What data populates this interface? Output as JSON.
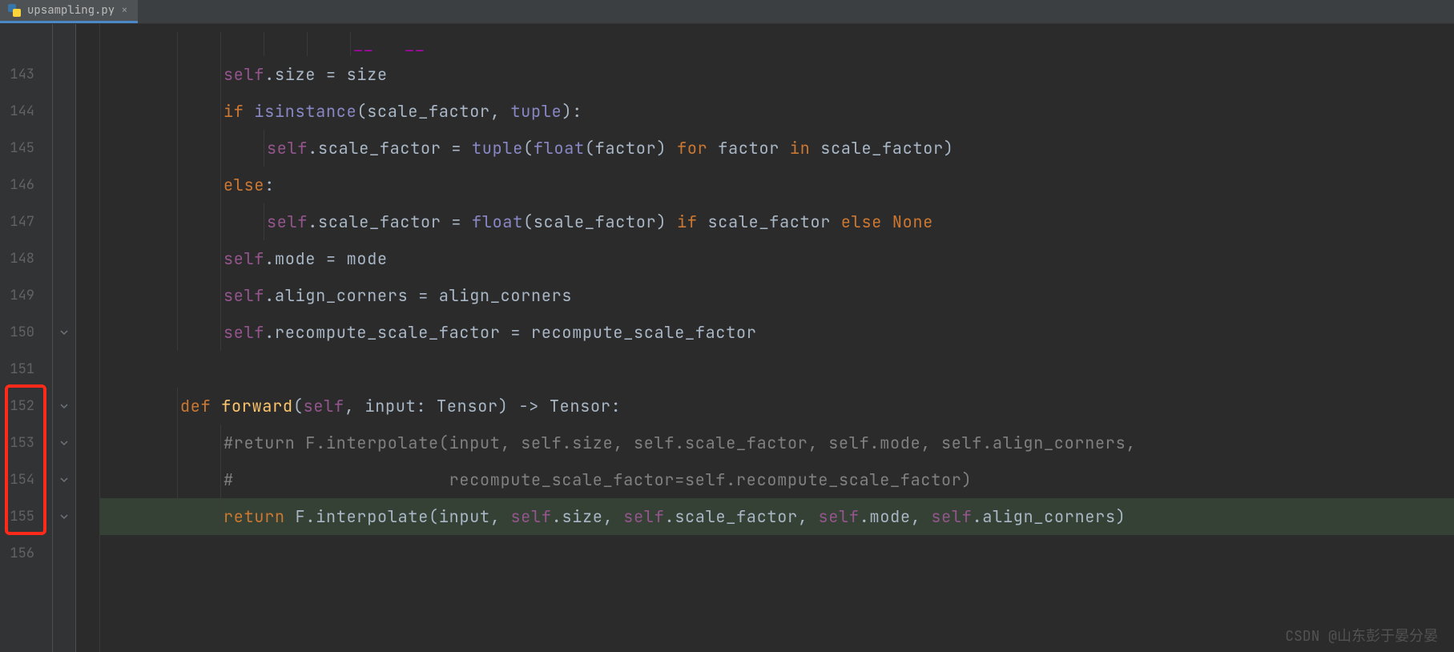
{
  "tab": {
    "filename": "upsampling.py",
    "close_glyph": "×"
  },
  "gutter": {
    "numbers": [
      "143",
      "144",
      "145",
      "146",
      "147",
      "148",
      "149",
      "150",
      "151",
      "152",
      "153",
      "154",
      "155",
      "156"
    ]
  },
  "redbox": {
    "start_index": 9,
    "end_index": 12
  },
  "fold_marks": {
    "150": true,
    "152": true,
    "153": true,
    "154": true,
    "155": true
  },
  "code": {
    "topcut": [
      {
        "cls": "c-dunder",
        "t": "__"
      },
      {
        "cls": "c-id",
        "t": "   "
      },
      {
        "cls": "c-dunder",
        "t": "__"
      }
    ],
    "lines": [
      {
        "indent": 2,
        "tokens": [
          {
            "cls": "c-self",
            "t": "self"
          },
          {
            "cls": "c-dot",
            "t": "."
          },
          {
            "cls": "c-id",
            "t": "size "
          },
          {
            "cls": "c-op",
            "t": "= "
          },
          {
            "cls": "c-id",
            "t": "size"
          }
        ]
      },
      {
        "indent": 2,
        "tokens": [
          {
            "cls": "c-kw",
            "t": "if "
          },
          {
            "cls": "c-builtin",
            "t": "isinstance"
          },
          {
            "cls": "c-punc",
            "t": "("
          },
          {
            "cls": "c-id",
            "t": "scale_factor"
          },
          {
            "cls": "c-punc",
            "t": ", "
          },
          {
            "cls": "c-builtin",
            "t": "tuple"
          },
          {
            "cls": "c-punc",
            "t": "):"
          }
        ]
      },
      {
        "indent": 3,
        "tokens": [
          {
            "cls": "c-self",
            "t": "self"
          },
          {
            "cls": "c-dot",
            "t": "."
          },
          {
            "cls": "c-id",
            "t": "scale_factor "
          },
          {
            "cls": "c-op",
            "t": "= "
          },
          {
            "cls": "c-builtin",
            "t": "tuple"
          },
          {
            "cls": "c-punc",
            "t": "("
          },
          {
            "cls": "c-builtin",
            "t": "float"
          },
          {
            "cls": "c-punc",
            "t": "("
          },
          {
            "cls": "c-id",
            "t": "factor"
          },
          {
            "cls": "c-punc",
            "t": ") "
          },
          {
            "cls": "c-kw",
            "t": "for "
          },
          {
            "cls": "c-id",
            "t": "factor "
          },
          {
            "cls": "c-kw",
            "t": "in "
          },
          {
            "cls": "c-id",
            "t": "scale_factor"
          },
          {
            "cls": "c-punc",
            "t": ")"
          }
        ]
      },
      {
        "indent": 2,
        "tokens": [
          {
            "cls": "c-kw",
            "t": "else"
          },
          {
            "cls": "c-punc",
            "t": ":"
          }
        ]
      },
      {
        "indent": 3,
        "tokens": [
          {
            "cls": "c-self",
            "t": "self"
          },
          {
            "cls": "c-dot",
            "t": "."
          },
          {
            "cls": "c-id",
            "t": "scale_factor "
          },
          {
            "cls": "c-op",
            "t": "= "
          },
          {
            "cls": "c-builtin",
            "t": "float"
          },
          {
            "cls": "c-punc",
            "t": "("
          },
          {
            "cls": "c-id",
            "t": "scale_factor"
          },
          {
            "cls": "c-punc",
            "t": ") "
          },
          {
            "cls": "c-kw",
            "t": "if "
          },
          {
            "cls": "c-id",
            "t": "scale_factor "
          },
          {
            "cls": "c-kw",
            "t": "else "
          },
          {
            "cls": "c-kw",
            "t": "None"
          }
        ]
      },
      {
        "indent": 2,
        "tokens": [
          {
            "cls": "c-self",
            "t": "self"
          },
          {
            "cls": "c-dot",
            "t": "."
          },
          {
            "cls": "c-id",
            "t": "mode "
          },
          {
            "cls": "c-op",
            "t": "= "
          },
          {
            "cls": "c-id",
            "t": "mode"
          }
        ]
      },
      {
        "indent": 2,
        "tokens": [
          {
            "cls": "c-self",
            "t": "self"
          },
          {
            "cls": "c-dot",
            "t": "."
          },
          {
            "cls": "c-id",
            "t": "align_corners "
          },
          {
            "cls": "c-op",
            "t": "= "
          },
          {
            "cls": "c-id",
            "t": "align_corners"
          }
        ]
      },
      {
        "indent": 2,
        "tokens": [
          {
            "cls": "c-self",
            "t": "self"
          },
          {
            "cls": "c-dot",
            "t": "."
          },
          {
            "cls": "c-id",
            "t": "recompute_scale_factor "
          },
          {
            "cls": "c-op",
            "t": "= "
          },
          {
            "cls": "c-id",
            "t": "recompute_scale_factor"
          }
        ]
      },
      {
        "indent": 0,
        "tokens": []
      },
      {
        "indent": 1,
        "tokens": [
          {
            "cls": "c-kw",
            "t": "def "
          },
          {
            "cls": "c-fn",
            "t": "forward"
          },
          {
            "cls": "c-punc",
            "t": "("
          },
          {
            "cls": "c-self",
            "t": "self"
          },
          {
            "cls": "c-punc",
            "t": ", "
          },
          {
            "cls": "c-param",
            "t": "input"
          },
          {
            "cls": "c-punc",
            "t": ": "
          },
          {
            "cls": "c-id",
            "t": "Tensor"
          },
          {
            "cls": "c-punc",
            "t": ") -> "
          },
          {
            "cls": "c-id",
            "t": "Tensor"
          },
          {
            "cls": "c-punc",
            "t": ":"
          }
        ]
      },
      {
        "indent": 2,
        "tokens": [
          {
            "cls": "c-comment",
            "t": "#return F.interpolate(input, self.size, self.scale_factor, self.mode, self.align_corners,"
          }
        ]
      },
      {
        "indent": 2,
        "tokens": [
          {
            "cls": "c-comment",
            "t": "#                     recompute_scale_factor=self.recompute_scale_factor)"
          }
        ]
      },
      {
        "indent": 2,
        "hl": true,
        "tokens": [
          {
            "cls": "c-kw",
            "t": "return "
          },
          {
            "cls": "c-id",
            "t": "F"
          },
          {
            "cls": "c-dot",
            "t": "."
          },
          {
            "cls": "c-id",
            "t": "interpolate"
          },
          {
            "cls": "c-punc",
            "t": "("
          },
          {
            "cls": "c-id",
            "t": "input"
          },
          {
            "cls": "c-punc",
            "t": ", "
          },
          {
            "cls": "c-self",
            "t": "self"
          },
          {
            "cls": "c-dot",
            "t": "."
          },
          {
            "cls": "c-id",
            "t": "size"
          },
          {
            "cls": "c-punc",
            "t": ", "
          },
          {
            "cls": "c-self",
            "t": "self"
          },
          {
            "cls": "c-dot",
            "t": "."
          },
          {
            "cls": "c-id",
            "t": "scale_factor"
          },
          {
            "cls": "c-punc",
            "t": ", "
          },
          {
            "cls": "c-self",
            "t": "self"
          },
          {
            "cls": "c-dot",
            "t": "."
          },
          {
            "cls": "c-id",
            "t": "mode"
          },
          {
            "cls": "c-punc",
            "t": ", "
          },
          {
            "cls": "c-self",
            "t": "self"
          },
          {
            "cls": "c-dot",
            "t": "."
          },
          {
            "cls": "c-id",
            "t": "align_corners"
          },
          {
            "cls": "c-punc",
            "t": ")"
          }
        ]
      },
      {
        "indent": 0,
        "tokens": []
      }
    ]
  },
  "watermark": "CSDN @山东彭于晏分晏"
}
